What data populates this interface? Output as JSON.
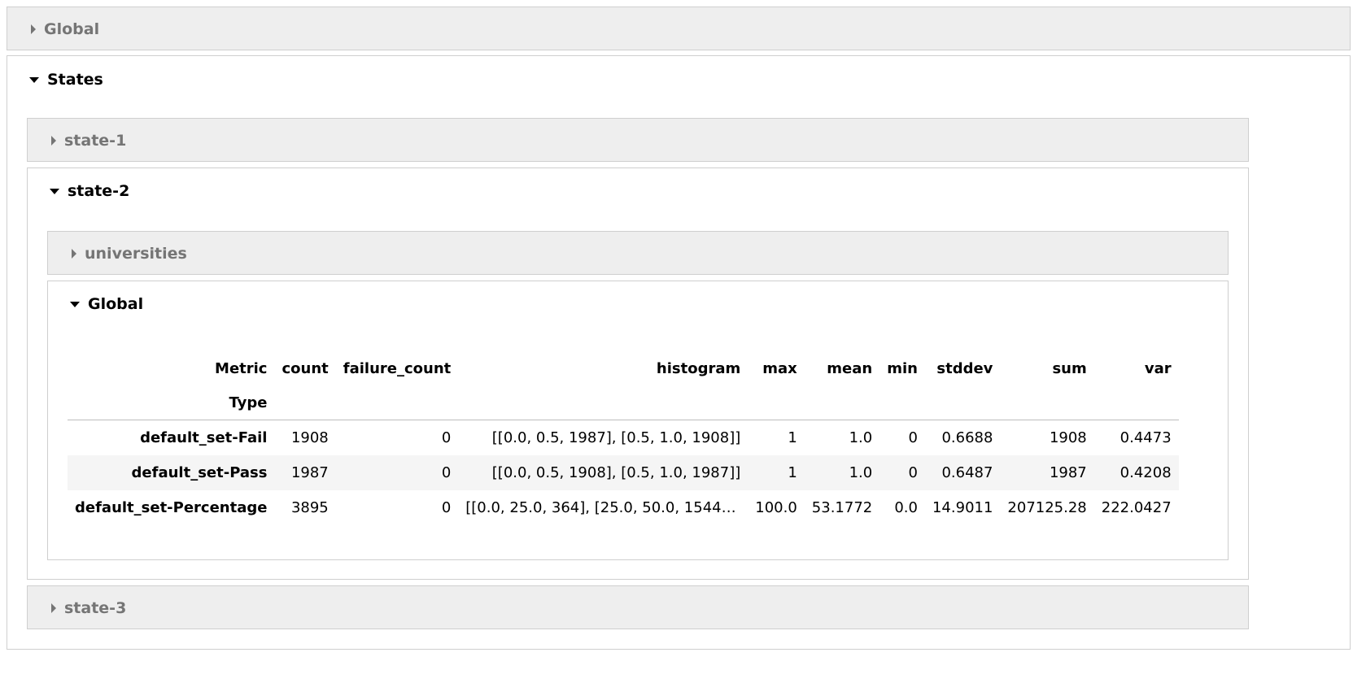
{
  "panels": {
    "global_top": "Global",
    "states": "States",
    "state1": "state-1",
    "state2": "state-2",
    "universities": "universities",
    "global_inner": "Global",
    "state3": "state-3"
  },
  "table": {
    "columns": [
      "count",
      "failure_count",
      "histogram",
      "max",
      "mean",
      "min",
      "stddev",
      "sum",
      "var"
    ],
    "index_header": "Metric",
    "index_subheader": "Type",
    "rows": [
      {
        "label": "default_set-Fail",
        "count": "1908",
        "failure_count": "0",
        "histogram": "[[0.0, 0.5, 1987], [0.5, 1.0, 1908]]",
        "max": "1",
        "mean": "1.0",
        "min": "0",
        "stddev": "0.6688",
        "sum": "1908",
        "var": "0.4473"
      },
      {
        "label": "default_set-Pass",
        "count": "1987",
        "failure_count": "0",
        "histogram": "[[0.0, 0.5, 1908], [0.5, 1.0, 1987]]",
        "max": "1",
        "mean": "1.0",
        "min": "0",
        "stddev": "0.6487",
        "sum": "1987",
        "var": "0.4208"
      },
      {
        "label": "default_set-Percentage",
        "count": "3895",
        "failure_count": "0",
        "histogram": "[[0.0, 25.0, 364], [25.0, 50.0, 1544], [50.0, ...",
        "max": "100.0",
        "mean": "53.1772",
        "min": "0.0",
        "stddev": "14.9011",
        "sum": "207125.28",
        "var": "222.0427"
      }
    ]
  }
}
